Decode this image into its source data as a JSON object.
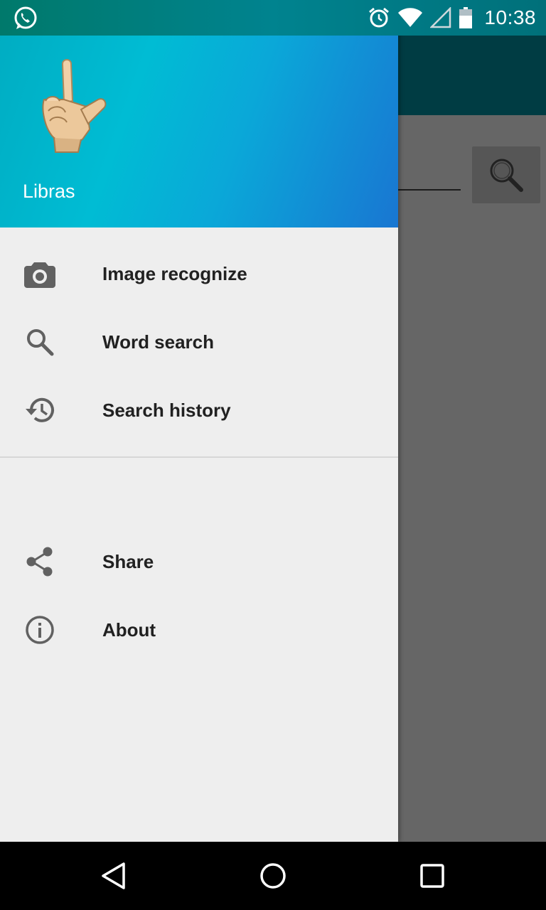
{
  "status_bar": {
    "time": "10:38",
    "left_icon": "whatsapp-icon",
    "right_icons": [
      "alarm-icon",
      "wifi-icon",
      "cell-signal-icon",
      "battery-icon"
    ]
  },
  "drawer": {
    "header": {
      "title": "Libras",
      "logo_icon": "hand-sign-l-icon",
      "gradient_colors": [
        "#00acc1",
        "#00bcd4",
        "#1976d2"
      ]
    },
    "primary_items": [
      {
        "label": "Image recognize",
        "icon": "camera-icon"
      },
      {
        "label": "Word search",
        "icon": "search-icon"
      },
      {
        "label": "Search history",
        "icon": "history-icon"
      }
    ],
    "secondary_items": [
      {
        "label": "Share",
        "icon": "share-icon"
      },
      {
        "label": "About",
        "icon": "info-icon"
      }
    ]
  },
  "background_app": {
    "toolbar_color": "#0097a7",
    "search_button_icon": "magnifier-icon"
  },
  "nav_bar": {
    "buttons": [
      "back-icon",
      "home-icon",
      "recents-icon"
    ]
  }
}
